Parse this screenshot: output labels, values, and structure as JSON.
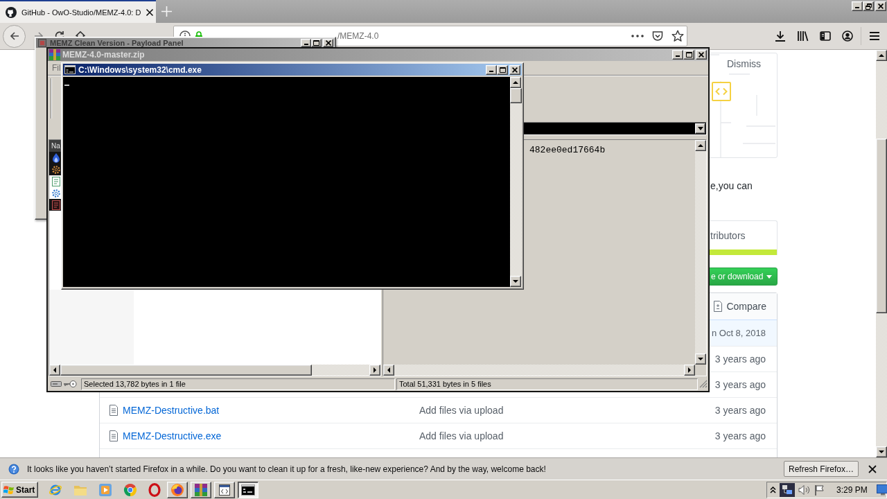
{
  "browser": {
    "tabs": [
      {
        "title": "GitHub - OwO-Studio/MEMZ-4.0: D",
        "selected": true
      }
    ],
    "address": "/MEMZ-4.0",
    "page": {
      "banner": {
        "action": "Dismiss"
      },
      "description": "e,you can",
      "summary": "tributors",
      "clone_button": "e or download",
      "compare_button": "Compare",
      "latest_commit": "n Oct 8, 2018",
      "files": [
        {
          "age": "3 years ago"
        },
        {
          "age": "3 years ago"
        },
        {
          "name": "MEMZ-Destructive.bat",
          "message": "Add files via upload",
          "age": "3 years ago"
        },
        {
          "name": "MEMZ-Destructive.exe",
          "message": "Add files via upload",
          "age": "3 years ago"
        }
      ]
    },
    "notification": {
      "message": "It looks like you haven’t started Firefox in a while. Do you want to clean it up for a fresh, like-new experience? And by the way, welcome back!",
      "button": "Refresh Firefox…"
    }
  },
  "windows": {
    "payload_panel": {
      "title": "MEMZ Clean Version - Payload Panel",
      "active": false
    },
    "archive": {
      "title": "MEMZ-4.0-master.zip",
      "active": false,
      "menu": [
        "Fil"
      ],
      "list_header": "Na",
      "rows": [
        {
          "kind": "flame",
          "highlighted": true
        },
        {
          "kind": "gear",
          "highlighted": true
        },
        {
          "kind": "document",
          "highlighted": false
        },
        {
          "kind": "gear",
          "highlighted": false
        },
        {
          "kind": "document",
          "highlighted": true
        }
      ],
      "comment": "482ee0ed17664b",
      "status": [
        "Selected 13,782 bytes in 1 file",
        "Total 51,331 bytes in 5 files"
      ]
    },
    "console": {
      "title": "C:\\Windows\\system32\\cmd.exe",
      "active": true
    }
  },
  "taskbar": {
    "start": "Start",
    "quick_launch": [
      {
        "kind": "globe"
      },
      {
        "kind": "folder"
      },
      {
        "kind": "player"
      },
      {
        "kind": "wheel"
      },
      {
        "kind": "ring"
      }
    ],
    "tasks": [
      {
        "kind": "fox",
        "selected": false
      },
      {
        "kind": "books",
        "selected": false
      },
      {
        "kind": "window",
        "selected": false
      },
      {
        "kind": "console",
        "selected": true
      }
    ],
    "clock": "3:29 PM"
  }
}
